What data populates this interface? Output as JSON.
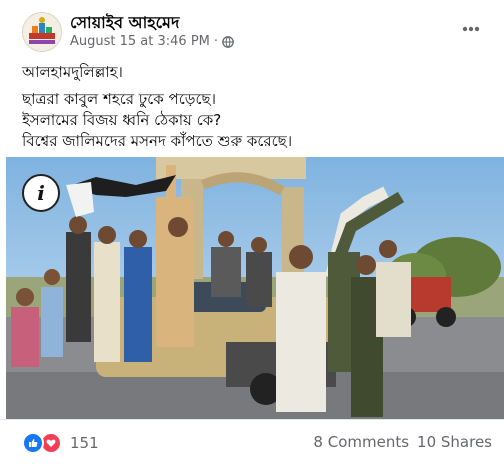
{
  "post": {
    "author": "সোয়াইব আহমেদ",
    "timestamp": "August 15 at 3:46 PM",
    "separator": "·",
    "privacy_icon": "globe-icon",
    "more_icon": "more-horizontal-icon",
    "text_lines": [
      "আলহামদুলিল্লাহ।",
      "ছাত্ররা কাবুল শহরে ঢুকে পড়েছে।",
      "ইসলামের বিজয় ধ্বনি ঠেকায় কে?",
      "বিশ্বের জালিমদের মসনদ কাঁপতে শুরু করেছে।"
    ]
  },
  "photo": {
    "badge_icon": "info-icon",
    "badge_text": "i"
  },
  "footer": {
    "reaction_icons": [
      "like-icon",
      "love-icon"
    ],
    "reaction_count": "151",
    "comments": "8 Comments",
    "shares": "10 Shares"
  },
  "colors": {
    "like": "#1877f2",
    "love": "#f33e58",
    "secondary_text": "#65676b"
  }
}
